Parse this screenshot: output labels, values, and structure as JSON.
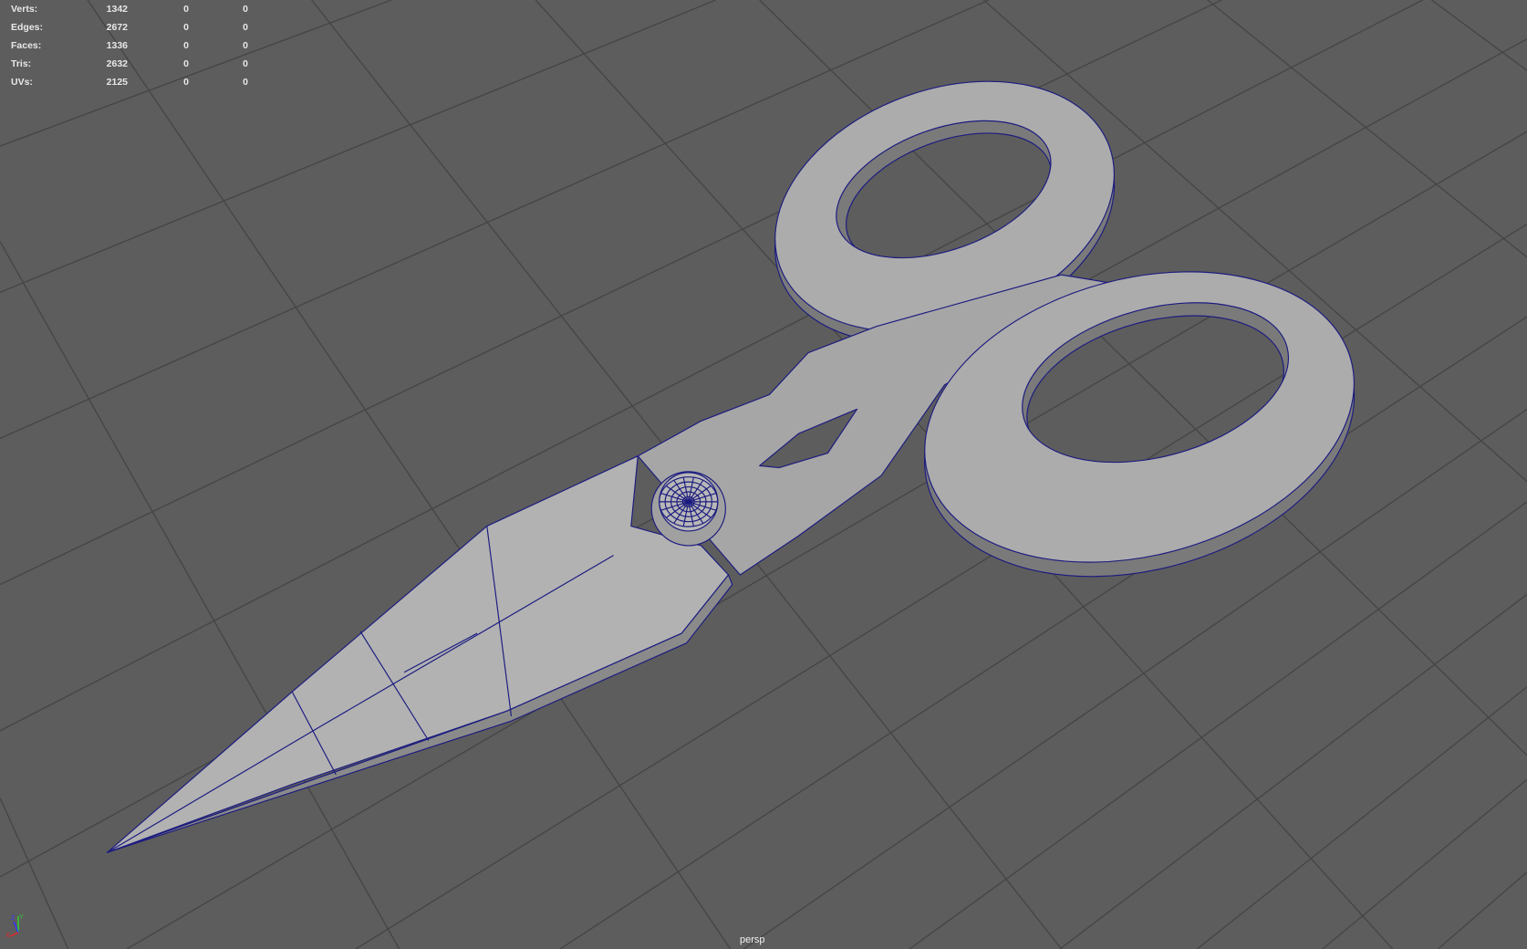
{
  "hud": {
    "rows": [
      {
        "label": "Verts:",
        "value": "1342",
        "selected": "0",
        "selected_component": "0"
      },
      {
        "label": "Edges:",
        "value": "2672",
        "selected": "0",
        "selected_component": "0"
      },
      {
        "label": "Faces:",
        "value": "1336",
        "selected": "0",
        "selected_component": "0"
      },
      {
        "label": "Tris:",
        "value": "2632",
        "selected": "0",
        "selected_component": "0"
      },
      {
        "label": "UVs:",
        "value": "2125",
        "selected": "0",
        "selected_component": "0"
      }
    ]
  },
  "camera": {
    "name": "persp"
  },
  "axis": {
    "x": "X",
    "y": "Y",
    "z": "Z"
  },
  "colors": {
    "background": "#5d5d5d",
    "grid": "#464646",
    "mesh": "#acacac",
    "wire": "#1c1c80"
  }
}
